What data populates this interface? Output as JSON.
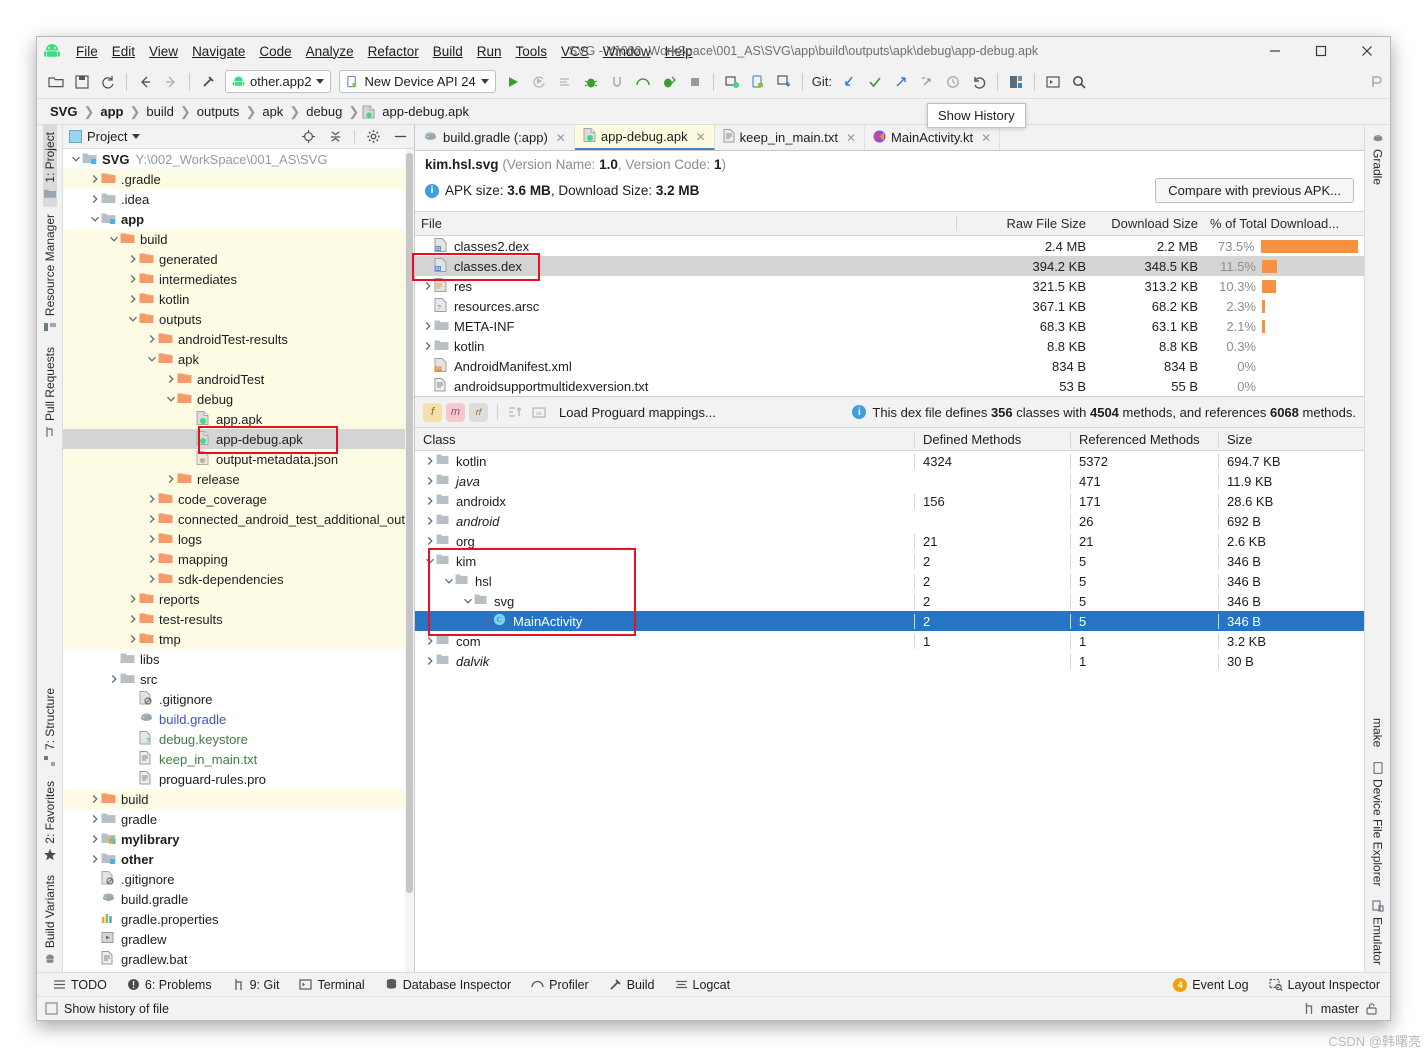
{
  "window": {
    "title": "SVG - Y:\\002_WorkSpace\\001_AS\\SVG\\app\\build\\outputs\\apk\\debug\\app-debug.apk",
    "minimize": "—",
    "maximize": "☐",
    "close": "✕"
  },
  "menubar": {
    "items": [
      "File",
      "Edit",
      "View",
      "Navigate",
      "Code",
      "Analyze",
      "Refactor",
      "Build",
      "Run",
      "Tools",
      "VCS",
      "Window",
      "Help"
    ]
  },
  "toolbar": {
    "module_combo": "other.app2",
    "device_combo": "New Device API 24",
    "git_label": "Git:"
  },
  "breadcrumb": {
    "items": [
      "SVG",
      "app",
      "build",
      "outputs",
      "apk",
      "debug",
      "app-debug.apk"
    ]
  },
  "left_strip": {
    "top": [
      {
        "label": "1: Project",
        "icon": "project-icon",
        "active": true
      },
      {
        "label": "Resource Manager",
        "icon": "resource-manager-icon",
        "active": false
      },
      {
        "label": "Pull Requests",
        "icon": "pull-requests-icon",
        "active": false
      }
    ],
    "bottom": [
      {
        "label": "7: Structure",
        "icon": "structure-icon"
      },
      {
        "label": "2: Favorites",
        "icon": "star-icon"
      },
      {
        "label": "Build Variants",
        "icon": "build-variants-icon"
      }
    ]
  },
  "right_strip": {
    "top": [
      {
        "label": "Gradle",
        "icon": "gradle-icon"
      }
    ],
    "bottom": [
      {
        "label": "make",
        "icon": "make-icon"
      },
      {
        "label": "Device File Explorer",
        "icon": "device-file-explorer-icon"
      },
      {
        "label": "Emulator",
        "icon": "emulator-icon"
      }
    ]
  },
  "project_panel": {
    "title": "Project",
    "tree": [
      {
        "indent": 0,
        "arrow": "down",
        "icon": "module-icon",
        "label": "SVG",
        "style": "bold",
        "suffix": "Y:\\002_WorkSpace\\001_AS\\SVG",
        "row": "plain"
      },
      {
        "indent": 1,
        "arrow": "right",
        "icon": "folder-orange",
        "label": ".gradle",
        "style": "",
        "row": "yellow"
      },
      {
        "indent": 1,
        "arrow": "right",
        "icon": "folder-grey",
        "label": ".idea",
        "style": "",
        "row": "plain"
      },
      {
        "indent": 1,
        "arrow": "down",
        "icon": "module-icon",
        "label": "app",
        "style": "bold",
        "row": "plain"
      },
      {
        "indent": 2,
        "arrow": "down",
        "icon": "folder-orange",
        "label": "build",
        "style": "",
        "row": "yellow"
      },
      {
        "indent": 3,
        "arrow": "right",
        "icon": "folder-orange",
        "label": "generated",
        "style": "",
        "row": "yellow"
      },
      {
        "indent": 3,
        "arrow": "right",
        "icon": "folder-orange",
        "label": "intermediates",
        "style": "",
        "row": "yellow"
      },
      {
        "indent": 3,
        "arrow": "right",
        "icon": "folder-orange",
        "label": "kotlin",
        "style": "",
        "row": "yellow"
      },
      {
        "indent": 3,
        "arrow": "down",
        "icon": "folder-orange",
        "label": "outputs",
        "style": "",
        "row": "yellow"
      },
      {
        "indent": 4,
        "arrow": "right",
        "icon": "folder-orange",
        "label": "androidTest-results",
        "style": "",
        "row": "yellow"
      },
      {
        "indent": 4,
        "arrow": "down",
        "icon": "folder-orange",
        "label": "apk",
        "style": "",
        "row": "yellow"
      },
      {
        "indent": 5,
        "arrow": "right",
        "icon": "folder-orange",
        "label": "androidTest",
        "style": "",
        "row": "yellow"
      },
      {
        "indent": 5,
        "arrow": "down",
        "icon": "folder-orange",
        "label": "debug",
        "style": "",
        "row": "yellow"
      },
      {
        "indent": 6,
        "arrow": "none",
        "icon": "apk-icon",
        "label": "app.apk",
        "style": "",
        "row": "yellow"
      },
      {
        "indent": 6,
        "arrow": "none",
        "icon": "apk-icon",
        "label": "app-debug.apk",
        "style": "",
        "row": "grey"
      },
      {
        "indent": 6,
        "arrow": "none",
        "icon": "json-icon",
        "label": "output-metadata.json",
        "style": "",
        "row": "yellow"
      },
      {
        "indent": 5,
        "arrow": "right",
        "icon": "folder-orange",
        "label": "release",
        "style": "",
        "row": "yellow"
      },
      {
        "indent": 4,
        "arrow": "right",
        "icon": "folder-orange",
        "label": "code_coverage",
        "style": "",
        "row": "yellow"
      },
      {
        "indent": 4,
        "arrow": "right",
        "icon": "folder-orange",
        "label": "connected_android_test_additional_outpu",
        "style": "",
        "row": "yellow"
      },
      {
        "indent": 4,
        "arrow": "right",
        "icon": "folder-orange",
        "label": "logs",
        "style": "",
        "row": "yellow"
      },
      {
        "indent": 4,
        "arrow": "right",
        "icon": "folder-orange",
        "label": "mapping",
        "style": "",
        "row": "yellow"
      },
      {
        "indent": 4,
        "arrow": "right",
        "icon": "folder-orange",
        "label": "sdk-dependencies",
        "style": "",
        "row": "yellow"
      },
      {
        "indent": 3,
        "arrow": "right",
        "icon": "folder-orange",
        "label": "reports",
        "style": "",
        "row": "yellow"
      },
      {
        "indent": 3,
        "arrow": "right",
        "icon": "folder-orange",
        "label": "test-results",
        "style": "",
        "row": "yellow"
      },
      {
        "indent": 3,
        "arrow": "right",
        "icon": "folder-orange",
        "label": "tmp",
        "style": "",
        "row": "yellow"
      },
      {
        "indent": 2,
        "arrow": "none",
        "icon": "folder-grey",
        "label": "libs",
        "style": "",
        "row": "plain"
      },
      {
        "indent": 2,
        "arrow": "right",
        "icon": "folder-grey",
        "label": "src",
        "style": "",
        "row": "plain"
      },
      {
        "indent": 3,
        "arrow": "none",
        "icon": "gitignore-icon",
        "label": ".gitignore",
        "style": "",
        "row": "plain"
      },
      {
        "indent": 3,
        "arrow": "none",
        "icon": "gradle-file-icon",
        "label": "build.gradle",
        "style": "blue",
        "row": "plain"
      },
      {
        "indent": 3,
        "arrow": "none",
        "icon": "keystore-icon",
        "label": "debug.keystore",
        "style": "green",
        "row": "plain"
      },
      {
        "indent": 3,
        "arrow": "none",
        "icon": "text-icon",
        "label": "keep_in_main.txt",
        "style": "green",
        "row": "plain"
      },
      {
        "indent": 3,
        "arrow": "none",
        "icon": "text-icon",
        "label": "proguard-rules.pro",
        "style": "",
        "row": "plain"
      },
      {
        "indent": 1,
        "arrow": "right",
        "icon": "folder-orange",
        "label": "build",
        "style": "",
        "row": "yellow"
      },
      {
        "indent": 1,
        "arrow": "right",
        "icon": "folder-grey",
        "label": "gradle",
        "style": "",
        "row": "plain"
      },
      {
        "indent": 1,
        "arrow": "right",
        "icon": "library-icon",
        "label": "mylibrary",
        "style": "bold",
        "row": "plain"
      },
      {
        "indent": 1,
        "arrow": "right",
        "icon": "module-icon",
        "label": "other",
        "style": "bold",
        "row": "plain"
      },
      {
        "indent": 1,
        "arrow": "none",
        "icon": "gitignore-icon",
        "label": ".gitignore",
        "style": "",
        "row": "plain"
      },
      {
        "indent": 1,
        "arrow": "none",
        "icon": "gradle-file-icon",
        "label": "build.gradle",
        "style": "",
        "row": "plain"
      },
      {
        "indent": 1,
        "arrow": "none",
        "icon": "properties-icon",
        "label": "gradle.properties",
        "style": "",
        "row": "plain"
      },
      {
        "indent": 1,
        "arrow": "none",
        "icon": "script-icon",
        "label": "gradlew",
        "style": "",
        "row": "plain"
      },
      {
        "indent": 1,
        "arrow": "none",
        "icon": "text-icon",
        "label": "gradlew.bat",
        "style": "",
        "row": "plain"
      }
    ]
  },
  "editor": {
    "tooltip": "Show History",
    "tabs": [
      {
        "label": "build.gradle (:app)",
        "icon": "gradle-file-icon",
        "active": false
      },
      {
        "label": "app-debug.apk",
        "icon": "apk-icon",
        "active": true
      },
      {
        "label": "keep_in_main.txt",
        "icon": "text-icon",
        "active": false
      },
      {
        "label": "MainActivity.kt",
        "icon": "kotlin-icon",
        "active": false
      }
    ],
    "apk_header": {
      "name": "kim.hsl.svg",
      "version_name_label": "Version Name:",
      "version_name": "1.0",
      "version_code_label": "Version Code:",
      "version_code": "1",
      "apk_size_label": "APK size:",
      "apk_size": "3.6 MB",
      "download_size_label": "Download Size:",
      "download_size": "3.2 MB",
      "compare_button": "Compare with previous APK..."
    },
    "file_table": {
      "columns": [
        "File",
        "Raw File Size",
        "Download Size",
        "% of Total Download..."
      ],
      "rows": [
        {
          "arrow": "none",
          "icon": "dex-icon",
          "name": "classes2.dex",
          "raw": "2.4 MB",
          "dl": "2.2 MB",
          "pct": "73.5%",
          "bar": 100,
          "selected": false
        },
        {
          "arrow": "none",
          "icon": "dex-icon",
          "name": "classes.dex",
          "raw": "394.2 KB",
          "dl": "348.5 KB",
          "pct": "11.5%",
          "bar": 15,
          "selected": true
        },
        {
          "arrow": "right",
          "icon": "res-icon",
          "name": "res",
          "raw": "321.5 KB",
          "dl": "313.2 KB",
          "pct": "10.3%",
          "bar": 14,
          "selected": false
        },
        {
          "arrow": "none",
          "icon": "arsc-icon",
          "name": "resources.arsc",
          "raw": "367.1 KB",
          "dl": "68.2 KB",
          "pct": "2.3%",
          "bar": 3,
          "selected": false
        },
        {
          "arrow": "right",
          "icon": "folder-grey",
          "name": "META-INF",
          "raw": "68.3 KB",
          "dl": "63.1 KB",
          "pct": "2.1%",
          "bar": 3,
          "selected": false
        },
        {
          "arrow": "right",
          "icon": "folder-grey",
          "name": "kotlin",
          "raw": "8.8 KB",
          "dl": "8.8 KB",
          "pct": "0.3%",
          "bar": 0,
          "selected": false
        },
        {
          "arrow": "none",
          "icon": "manifest-icon",
          "name": "AndroidManifest.xml",
          "raw": "834 B",
          "dl": "834 B",
          "pct": "0%",
          "bar": 0,
          "selected": false
        },
        {
          "arrow": "none",
          "icon": "text-icon",
          "name": "androidsupportmultidexversion.txt",
          "raw": "53 B",
          "dl": "55 B",
          "pct": "0%",
          "bar": 0,
          "selected": false
        }
      ]
    },
    "dex_panel": {
      "filters": [
        "f",
        "m",
        "rf"
      ],
      "load_proguard": "Load Proguard mappings...",
      "summary_prefix": "This dex file defines",
      "classes_count": "356",
      "summary_mid1": "classes with",
      "methods_count": "4504",
      "summary_mid2": "methods, and references",
      "refs_count": "6068",
      "summary_suffix": "methods.",
      "columns": [
        "Class",
        "Defined Methods",
        "Referenced Methods",
        "Size"
      ],
      "rows": [
        {
          "indent": 0,
          "arrow": "right",
          "icon": "package-icon",
          "name": "kotlin",
          "italic": false,
          "def": "4324",
          "ref": "5372",
          "size": "694.7 KB",
          "selected": false
        },
        {
          "indent": 0,
          "arrow": "right",
          "icon": "package-icon",
          "name": "java",
          "italic": true,
          "def": "",
          "ref": "471",
          "size": "11.9 KB",
          "selected": false
        },
        {
          "indent": 0,
          "arrow": "right",
          "icon": "package-icon",
          "name": "androidx",
          "italic": false,
          "def": "156",
          "ref": "171",
          "size": "28.6 KB",
          "selected": false
        },
        {
          "indent": 0,
          "arrow": "right",
          "icon": "package-icon",
          "name": "android",
          "italic": true,
          "def": "",
          "ref": "26",
          "size": "692 B",
          "selected": false
        },
        {
          "indent": 0,
          "arrow": "right",
          "icon": "package-icon",
          "name": "org",
          "italic": false,
          "def": "21",
          "ref": "21",
          "size": "2.6 KB",
          "selected": false
        },
        {
          "indent": 0,
          "arrow": "down",
          "icon": "package-icon",
          "name": "kim",
          "italic": false,
          "def": "2",
          "ref": "5",
          "size": "346 B",
          "selected": false
        },
        {
          "indent": 1,
          "arrow": "down",
          "icon": "package-icon",
          "name": "hsl",
          "italic": false,
          "def": "2",
          "ref": "5",
          "size": "346 B",
          "selected": false
        },
        {
          "indent": 2,
          "arrow": "down",
          "icon": "package-icon",
          "name": "svg",
          "italic": false,
          "def": "2",
          "ref": "5",
          "size": "346 B",
          "selected": false
        },
        {
          "indent": 3,
          "arrow": "right",
          "icon": "class-icon",
          "name": "MainActivity",
          "italic": false,
          "def": "2",
          "ref": "5",
          "size": "346 B",
          "selected": true
        },
        {
          "indent": 0,
          "arrow": "right",
          "icon": "package-icon",
          "name": "com",
          "italic": false,
          "def": "1",
          "ref": "1",
          "size": "3.2 KB",
          "selected": false
        },
        {
          "indent": 0,
          "arrow": "right",
          "icon": "package-icon",
          "name": "dalvik",
          "italic": true,
          "def": "",
          "ref": "1",
          "size": "30 B",
          "selected": false
        }
      ]
    }
  },
  "statusbar": {
    "items": [
      {
        "label": "TODO",
        "icon": "todo-icon"
      },
      {
        "label": "6: Problems",
        "icon": "problems-icon"
      },
      {
        "label": "9: Git",
        "icon": "git-icon"
      },
      {
        "label": "Terminal",
        "icon": "terminal-icon"
      },
      {
        "label": "Database Inspector",
        "icon": "database-icon"
      },
      {
        "label": "Profiler",
        "icon": "profiler-icon"
      },
      {
        "label": "Build",
        "icon": "build-icon"
      },
      {
        "label": "Logcat",
        "icon": "logcat-icon"
      }
    ],
    "right": [
      {
        "label": "Event Log",
        "icon": "event-log-icon",
        "badge": "4"
      },
      {
        "label": "Layout Inspector",
        "icon": "layout-inspector-icon",
        "badge": ""
      }
    ]
  },
  "statusbar2": {
    "left_label": "Show history of file",
    "branch": "master"
  },
  "watermark": "CSDN @韩曙亮",
  "colors": {
    "accent_orange": "#f79240",
    "selection_blue": "#2675c4",
    "tab_yellow": "#fdfbdd",
    "annotation_red": "#e81123"
  }
}
